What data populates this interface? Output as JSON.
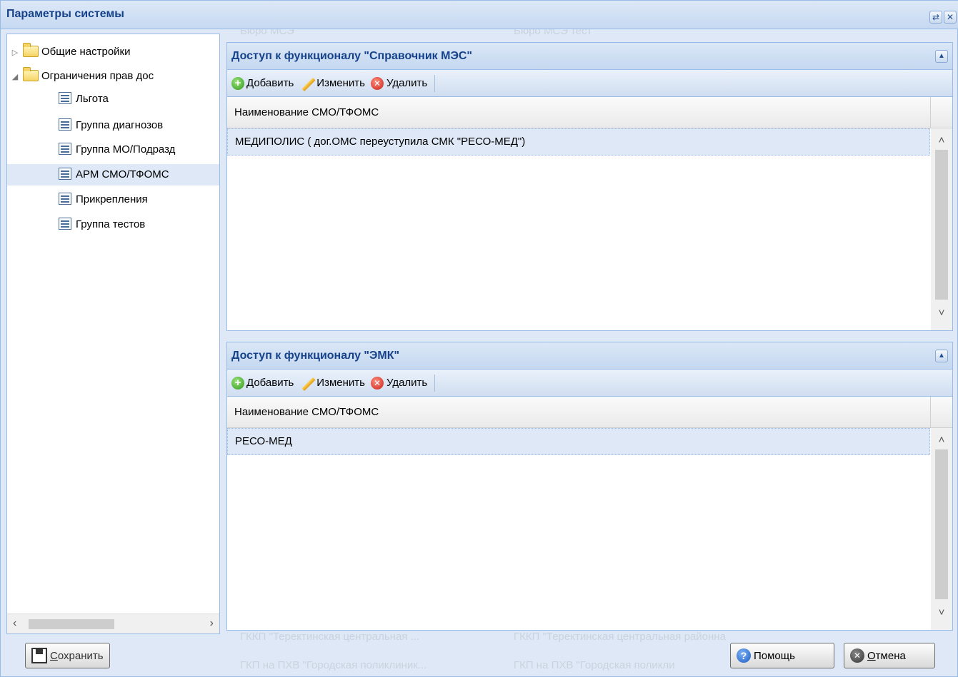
{
  "window": {
    "title": "Параметры системы",
    "refresh_icon": "refresh-icon",
    "close_icon": "close-icon"
  },
  "background_ghost_text": [
    "Бюро МСЭ",
    "Бюро МСЭ тест",
    "ГККП \"Теректинская центральная ...",
    "ГККП \"Теректинская центральная районна",
    "ГКП на ПХВ \"Городская поликлиник...",
    "ГКП на ПХВ \"Городская поликли"
  ],
  "tree": {
    "items": [
      {
        "label": "Общие настройки",
        "type": "folder",
        "expanded": false
      },
      {
        "label": "Ограничения прав дос",
        "type": "folder",
        "expanded": true
      },
      {
        "label": "Льгота",
        "type": "leaf"
      },
      {
        "label": "Группа диагнозов",
        "type": "leaf"
      },
      {
        "label": "Группа МО/Подразд",
        "type": "leaf"
      },
      {
        "label": "АРМ СМО/ТФОМС",
        "type": "leaf",
        "selected": true
      },
      {
        "label": "Прикрепления",
        "type": "leaf"
      },
      {
        "label": "Группа тестов",
        "type": "leaf"
      }
    ]
  },
  "sections": [
    {
      "title": "Доступ к функционалу \"Справочник МЭС\"",
      "toolbar": {
        "add": "Добавить",
        "edit": "Изменить",
        "delete": "Удалить"
      },
      "column": "Наименование СМО/ТФОМС",
      "rows": [
        "МЕДИПОЛИС ( дог.ОМС переуступила СМК \"РЕСО-МЕД\")"
      ]
    },
    {
      "title": "Доступ к функционалу \"ЭМК\"",
      "toolbar": {
        "add": "Добавить",
        "edit": "Изменить",
        "delete": "Удалить"
      },
      "column": "Наименование СМО/ТФОМС",
      "rows": [
        "РЕСО-МЕД"
      ]
    }
  ],
  "footer": {
    "save": "Сохранить",
    "help": "Помощь",
    "cancel": "Отмена"
  }
}
